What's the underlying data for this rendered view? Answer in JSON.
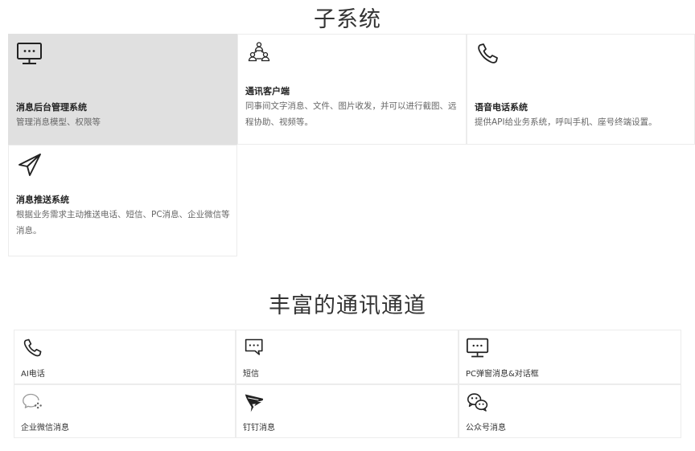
{
  "sections": {
    "subsystems_title": "子系统",
    "channels_title": "丰富的通讯通道"
  },
  "subsystems": [
    {
      "name": "消息后台管理系统",
      "desc": "管理消息模型、权限等",
      "icon": "monitor-icon"
    },
    {
      "name": "通讯客户端",
      "desc": "同事间文字消息、文件、图片收发，并可以进行截图、远程协助、视频等。",
      "icon": "users-network-icon"
    },
    {
      "name": "语音电话系统",
      "desc": "提供API给业务系统，呼叫手机、座号终端设置。",
      "icon": "phone-icon"
    },
    {
      "name": "消息推送系统",
      "desc": "根据业务需求主动推送电话、短信、PC消息、企业微信等消息。",
      "icon": "send-icon"
    }
  ],
  "channels": [
    {
      "label": "AI电话",
      "icon": "phone-icon"
    },
    {
      "label": "短信",
      "icon": "message-icon"
    },
    {
      "label": "PC弹窗消息&对话框",
      "icon": "monitor-icon"
    },
    {
      "label": "企业微信消息",
      "icon": "wecom-icon"
    },
    {
      "label": "钉钉消息",
      "icon": "dingtalk-icon"
    },
    {
      "label": "公众号消息",
      "icon": "wechat-icon"
    }
  ]
}
